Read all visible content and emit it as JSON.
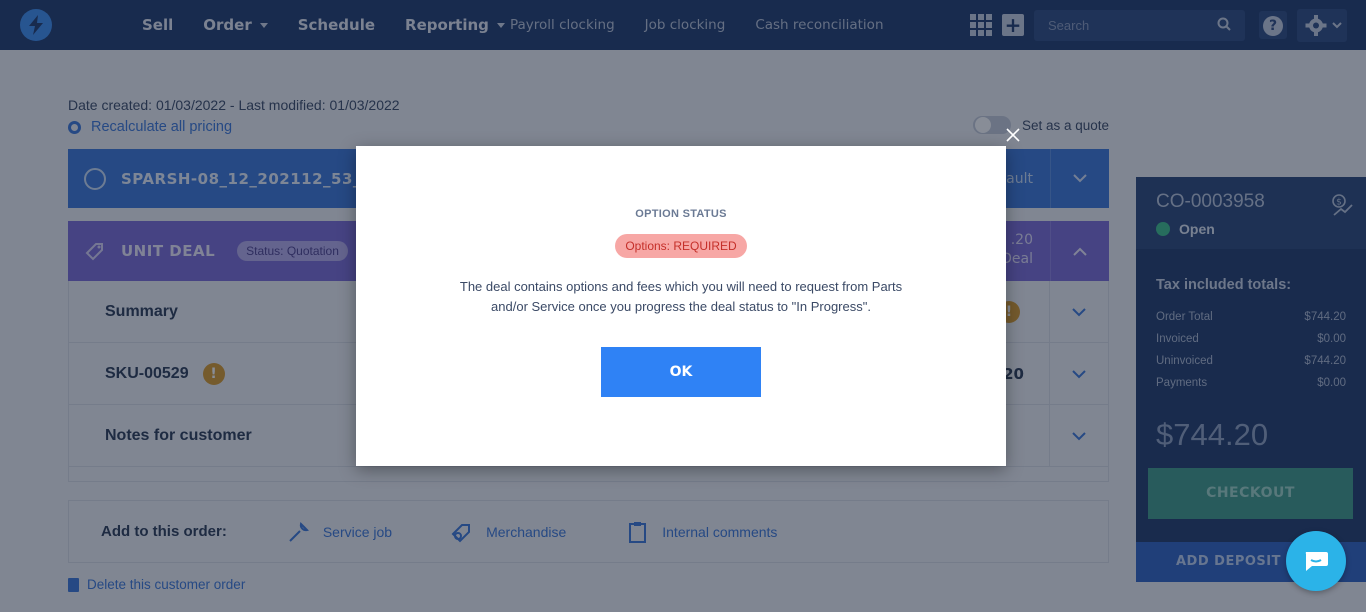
{
  "nav": {
    "main": [
      {
        "label": "Sell",
        "caret": false
      },
      {
        "label": "Order",
        "caret": true
      },
      {
        "label": "Schedule",
        "caret": false
      },
      {
        "label": "Reporting",
        "caret": true
      }
    ],
    "secondary": [
      "Payroll clocking",
      "Job clocking",
      "Cash reconciliation"
    ],
    "search_placeholder": "Search"
  },
  "page": {
    "dates": "Date created: 01/03/2022 - Last modified: 01/03/2022",
    "recalc": "Recalculate all pricing",
    "quote_label": "Set as a quote",
    "customer": {
      "name": "SPARSH-08_12_202112_53_04",
      "right_text": "ault"
    },
    "unit_deal": {
      "label": "UNIT DEAL",
      "status": "Status: Quotation",
      "amount_line1": ".20",
      "amount_line2": "Deal"
    },
    "rows": [
      {
        "label": "Summary"
      },
      {
        "label": "SKU-00529",
        "value": "20"
      },
      {
        "label": "Notes for customer"
      }
    ],
    "add_order": {
      "title": "Add to this order:",
      "items": [
        "Service job",
        "Merchandise",
        "Internal comments"
      ]
    },
    "delete": "Delete this customer order"
  },
  "panel": {
    "co_id": "CO-0003958",
    "status": "Open",
    "tax_title": "Tax included totals:",
    "lines": [
      {
        "label": "Order Total",
        "value": "$744.20"
      },
      {
        "label": "Invoiced",
        "value": "$0.00"
      },
      {
        "label": "Uninvoiced",
        "value": "$744.20"
      },
      {
        "label": "Payments",
        "value": "$0.00"
      }
    ],
    "total": "$744.20",
    "checkout": "CHECKOUT",
    "deposit": "ADD DEPOSIT"
  },
  "modal": {
    "title": "OPTION STATUS",
    "badge": "Options: REQUIRED",
    "message": "The deal contains options and fees which you will need to request from Parts and/or Service once you progress the deal status to \"In Progress\".",
    "ok": "OK"
  },
  "colors": {
    "nav_bg": "#1f3a6d",
    "accent": "#2f82f5",
    "unit_deal": "#7a6bd6",
    "customer_bar": "#3b77d9",
    "status_open": "#3dbf8a",
    "warning": "#d99a2b"
  }
}
